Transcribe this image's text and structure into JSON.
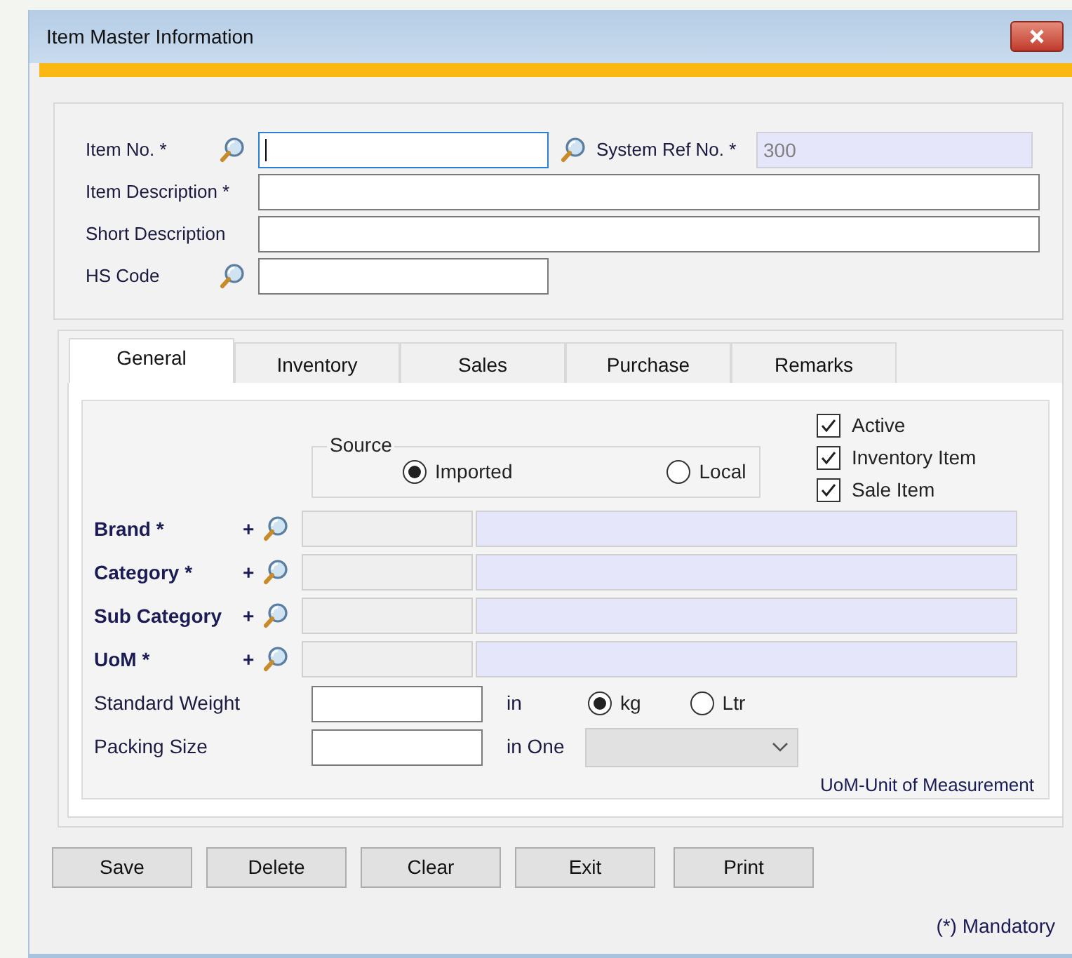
{
  "window": {
    "title": "Item Master Information"
  },
  "header": {
    "item_no": {
      "label": "Item No. *",
      "focused": true
    },
    "system_ref": {
      "label": "System Ref No. *",
      "value": "300"
    },
    "item_description": {
      "label": "Item Description *"
    },
    "short_description": {
      "label": "Short Description"
    },
    "hs_code": {
      "label": "HS Code"
    }
  },
  "tabs": [
    {
      "label": "General",
      "selected": true
    },
    {
      "label": "Inventory",
      "selected": false
    },
    {
      "label": "Sales",
      "selected": false
    },
    {
      "label": "Purchase",
      "selected": false
    },
    {
      "label": "Remarks",
      "selected": false
    }
  ],
  "source": {
    "legend": "Source",
    "options": [
      {
        "label": "Imported",
        "selected": true
      },
      {
        "label": "Local",
        "selected": false
      }
    ]
  },
  "flags": [
    {
      "label": "Active",
      "checked": true
    },
    {
      "label": "Inventory Item",
      "checked": true
    },
    {
      "label": "Sale Item",
      "checked": true
    }
  ],
  "lookups": [
    {
      "label": "Brand *",
      "add": "+"
    },
    {
      "label": "Category *",
      "add": "+"
    },
    {
      "label": "Sub Category",
      "add": "+"
    },
    {
      "label": "UoM *",
      "add": "+"
    }
  ],
  "standard_weight": {
    "label": "Standard Weight",
    "unit_label": "in",
    "units": [
      {
        "label": "kg",
        "selected": true
      },
      {
        "label": "Ltr",
        "selected": false
      }
    ]
  },
  "packing_size": {
    "label": "Packing Size",
    "unit_label": "in One",
    "dropdown_disabled": true
  },
  "note": "UoM-Unit of Measurement",
  "buttons": [
    "Save",
    "Delete",
    "Clear",
    "Exit",
    "Print"
  ],
  "footnote": "(*) Mandatory"
}
